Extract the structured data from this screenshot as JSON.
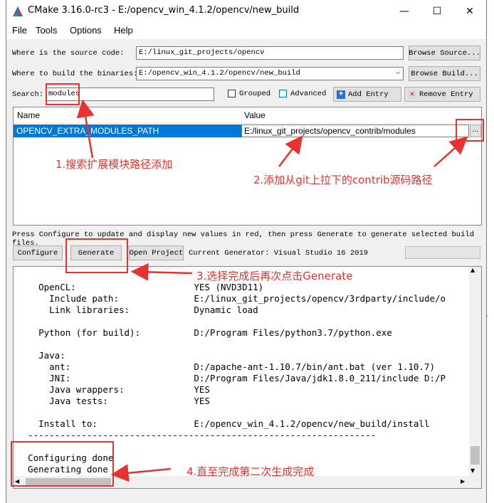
{
  "window": {
    "title": "CMake 3.16.0-rc3 - E:/opencv_win_4.1.2/opencv/new_build",
    "minimize": "—",
    "maximize": "☐",
    "close": "✕"
  },
  "menu": [
    "File",
    "Tools",
    "Options",
    "Help"
  ],
  "source": {
    "label": "Where is the source code:",
    "value": "E:/linux_git_projects/opencv",
    "browse": "Browse Source..."
  },
  "build": {
    "label": "Where to build the binaries:",
    "value": "E:/opencv_win_4.1.2/opencv/new_build",
    "browse": "Browse Build..."
  },
  "search": {
    "label": "Search:",
    "value": "modules",
    "grouped": "Grouped",
    "advanced": "Advanced",
    "add_entry": "Add Entry",
    "remove_entry": "Remove Entry"
  },
  "table": {
    "col_name": "Name",
    "col_value": "Value",
    "rows": [
      {
        "name": "OPENCV_EXTRA_MODULES_PATH",
        "value": "E:/linux_git_projects/opencv_contrib/modules",
        "button": "..."
      }
    ]
  },
  "hint": "Press Configure to update and display new values in red, then press Generate to generate selected build files.",
  "actions": {
    "configure": "Configure",
    "generate": "Generate",
    "open_project": "Open Project",
    "current_generator": "Current Generator: Visual Studio 16 2019"
  },
  "output_lines": [
    "    OpenCL:                      YES (NVD3D11)",
    "      Include path:              E:/linux_git_projects/opencv/3rdparty/include/o",
    "      Link libraries:            Dynamic load",
    "",
    "    Python (for build):          D:/Program Files/python3.7/python.exe",
    "",
    "    Java:",
    "      ant:                       D:/apache-ant-1.10.7/bin/ant.bat (ver 1.10.7)",
    "      JNI:                       D:/Program Files/Java/jdk1.8.0_211/include D:/P",
    "      Java wrappers:             YES",
    "      Java tests:                YES",
    "",
    "    Install to:                  E:/opencv_win_4.1.2/opencv/new_build/install",
    "  -----------------------------------------------------------------",
    "",
    "  Configuring done",
    "  Generating done"
  ],
  "annotations": {
    "a1": "1.搜索扩展模块路径添加",
    "a2": "2.添加从git上拉下的contrib源码路径",
    "a3": "3.选择完成后再次点击Generate",
    "a4": "4.直至完成第二次生成完成"
  },
  "colors": {
    "annotation": "#e8322f",
    "selection": "#0078d7"
  }
}
